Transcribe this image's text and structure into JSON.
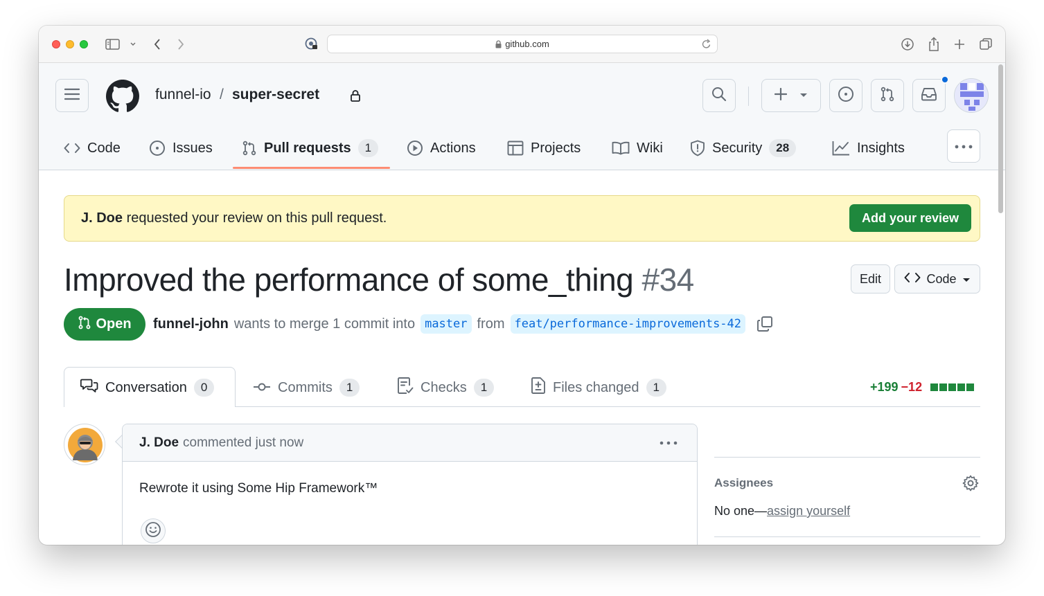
{
  "browser": {
    "url": "github.com"
  },
  "header": {
    "owner": "funnel-io",
    "separator": "/",
    "repo": "super-secret"
  },
  "nav": {
    "code": "Code",
    "issues": "Issues",
    "pull_requests": "Pull requests",
    "pull_requests_count": "1",
    "actions": "Actions",
    "projects": "Projects",
    "wiki": "Wiki",
    "security": "Security",
    "security_count": "28",
    "insights": "Insights"
  },
  "banner": {
    "user": "J. Doe",
    "message": "requested your review on this pull request.",
    "button": "Add your review"
  },
  "pr": {
    "title": "Improved the performance of some_thing",
    "number": "#34",
    "edit_label": "Edit",
    "code_label": "Code",
    "state": "Open",
    "author": "funnel-john",
    "merge_text": "wants to merge 1 commit into",
    "base_branch": "master",
    "from_text": "from",
    "head_branch": "feat/performance-improvements-42"
  },
  "tabs": {
    "conversation": "Conversation",
    "conversation_count": "0",
    "commits": "Commits",
    "commits_count": "1",
    "checks": "Checks",
    "checks_count": "1",
    "files": "Files changed",
    "files_count": "1"
  },
  "diffstat": {
    "additions": "+199",
    "deletions": "−12"
  },
  "comment": {
    "author": "J. Doe",
    "meta": "commented just now",
    "body": "Rewrote it using Some Hip Framework™"
  },
  "sidebar": {
    "assignees_title": "Assignees",
    "assignees_value": "No one—",
    "assign_link": "assign yourself"
  },
  "colors": {
    "primary_green": "#1f883d",
    "banner_bg": "#fff8c5",
    "link_blue": "#0969da",
    "tab_underline": "#fd8c73"
  }
}
